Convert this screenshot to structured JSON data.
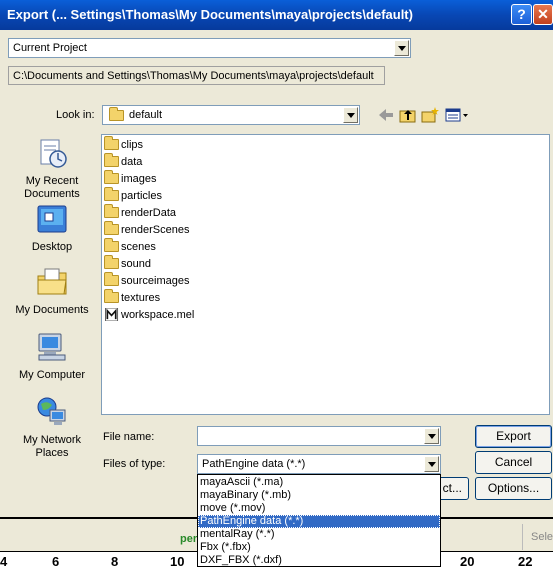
{
  "titlebar": {
    "title": "Export (... Settings\\Thomas\\My Documents\\maya\\projects\\default)",
    "help_glyph": "?",
    "close_glyph": "✕"
  },
  "project": {
    "selected": "Current Project",
    "path": "C:\\Documents and Settings\\Thomas\\My Documents\\maya\\projects\\default"
  },
  "look_in": {
    "label": "Look in:",
    "value": "default",
    "icons": [
      "back-icon",
      "up-folder-icon",
      "new-folder-icon",
      "view-menu-icon"
    ]
  },
  "places": [
    {
      "label": "My Recent Documents",
      "icon": "recent-documents-icon"
    },
    {
      "label": "Desktop",
      "icon": "desktop-icon"
    },
    {
      "label": "My Documents",
      "icon": "my-documents-icon"
    },
    {
      "label": "My Computer",
      "icon": "my-computer-icon"
    },
    {
      "label": "My Network Places",
      "icon": "network-places-icon"
    }
  ],
  "files": [
    {
      "name": "clips",
      "type": "folder"
    },
    {
      "name": "data",
      "type": "folder"
    },
    {
      "name": "images",
      "type": "folder"
    },
    {
      "name": "particles",
      "type": "folder"
    },
    {
      "name": "renderData",
      "type": "folder"
    },
    {
      "name": "renderScenes",
      "type": "folder"
    },
    {
      "name": "scenes",
      "type": "folder"
    },
    {
      "name": "sound",
      "type": "folder"
    },
    {
      "name": "sourceimages",
      "type": "folder"
    },
    {
      "name": "textures",
      "type": "folder"
    },
    {
      "name": "workspace.mel",
      "type": "maya-file"
    }
  ],
  "form": {
    "file_name_label": "File name:",
    "file_name_value": "",
    "files_of_type_label": "Files of type:",
    "files_of_type_value": "PathEngine data (*.*)"
  },
  "type_options": [
    "mayaAscii (*.ma)",
    "mayaBinary (*.mb)",
    "move (*.mov)",
    "PathEngine data (*.*)",
    "mentalRay (*.*)",
    "Fbx (*.fbx)",
    "DXF_FBX (*.dxf)"
  ],
  "selected_type_index": 3,
  "buttons": {
    "export": "Export",
    "cancel": "Cancel",
    "hidden_partial": "ct...",
    "options": "Options..."
  },
  "background": {
    "status_text": "per",
    "select_button": "Sele",
    "ruler_ticks": [
      "4",
      "6",
      "8",
      "10",
      "20",
      "22"
    ]
  },
  "colors": {
    "titlebar": "#0847b4",
    "dialog_bg": "#ece9d8",
    "selection": "#316ac5",
    "status_green": "#2a8a2a"
  }
}
